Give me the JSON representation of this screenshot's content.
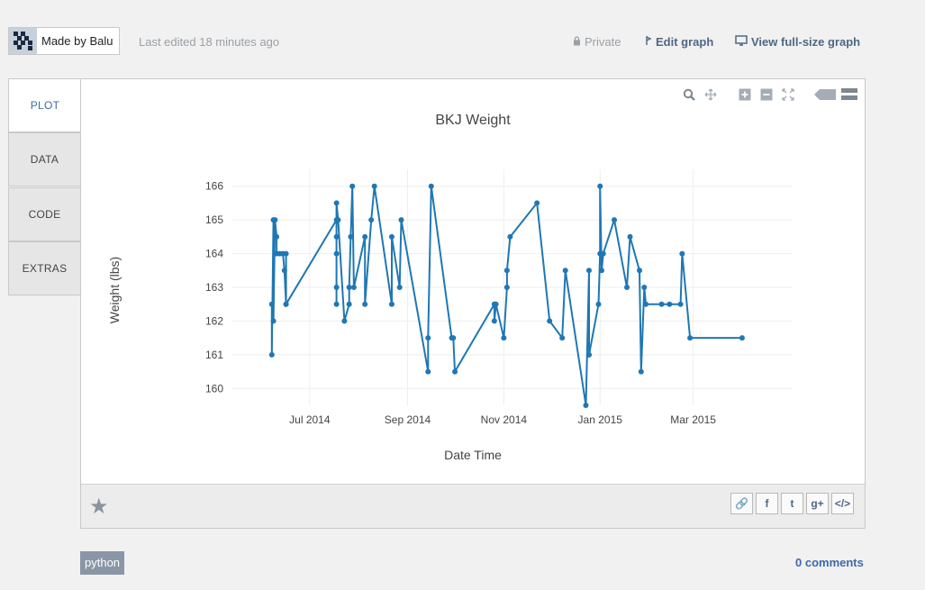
{
  "header": {
    "author": "Made by Balu",
    "last_edited": "Last edited 18 minutes ago",
    "private_label": "Private",
    "edit_label": "Edit graph",
    "view_label": "View full-size graph"
  },
  "tabs": [
    {
      "label": "PLOT",
      "active": true
    },
    {
      "label": "DATA",
      "active": false
    },
    {
      "label": "CODE",
      "active": false
    },
    {
      "label": "EXTRAS",
      "active": false
    }
  ],
  "modebar_icons": [
    "zoom-icon",
    "pan-icon",
    "zoom-in-icon",
    "zoom-out-icon",
    "autoscale-icon",
    "hover-closest-icon",
    "hover-compare-icon"
  ],
  "share_buttons": [
    {
      "name": "link-icon",
      "glyph": "🔗"
    },
    {
      "name": "facebook-icon",
      "glyph": "f"
    },
    {
      "name": "twitter-icon",
      "glyph": "t"
    },
    {
      "name": "google-plus-icon",
      "glyph": "g+"
    },
    {
      "name": "embed-icon",
      "glyph": "</>"
    }
  ],
  "tag": "python",
  "comments": "0 comments",
  "colors": {
    "line": "#1f77b4",
    "accent": "#3e6aa8"
  },
  "chart_data": {
    "type": "line",
    "title": "BKJ Weight",
    "xlabel": "Date Time",
    "ylabel": "Weight (lbs)",
    "ylim": [
      159.5,
      166.5
    ],
    "yticks": [
      160,
      161,
      162,
      163,
      164,
      165,
      166
    ],
    "xticks": [
      {
        "date": "2014-07-01",
        "label": "Jul 2014"
      },
      {
        "date": "2014-09-01",
        "label": "Sep 2014"
      },
      {
        "date": "2014-11-01",
        "label": "Nov 2014"
      },
      {
        "date": "2015-01-01",
        "label": "Jan 2015"
      },
      {
        "date": "2015-03-01",
        "label": "Mar 2015"
      }
    ],
    "xlim": [
      "2014-05-13",
      "2015-05-03"
    ],
    "grid": true,
    "series": [
      {
        "points": [
          [
            "2014-06-07",
            162.5
          ],
          [
            "2014-06-07",
            161.0
          ],
          [
            "2014-06-08",
            165.0
          ],
          [
            "2014-06-08",
            162.0
          ],
          [
            "2014-06-09",
            165.0
          ],
          [
            "2014-06-10",
            164.5
          ],
          [
            "2014-06-10",
            164.0
          ],
          [
            "2014-06-12",
            164.0
          ],
          [
            "2014-06-14",
            164.0
          ],
          [
            "2014-06-15",
            163.5
          ],
          [
            "2014-06-16",
            162.5
          ],
          [
            "2014-06-16",
            164.0
          ],
          [
            "2014-06-16",
            162.5
          ],
          [
            "2014-07-18",
            165.0
          ],
          [
            "2014-07-18",
            164.5
          ],
          [
            "2014-07-18",
            164.0
          ],
          [
            "2014-07-18",
            163.0
          ],
          [
            "2014-07-18",
            162.5
          ],
          [
            "2014-07-18",
            165.5
          ],
          [
            "2014-07-19",
            165.0
          ],
          [
            "2014-07-23",
            162.0
          ],
          [
            "2014-07-26",
            162.5
          ],
          [
            "2014-07-26",
            163.0
          ],
          [
            "2014-07-27",
            164.5
          ],
          [
            "2014-07-28",
            166.0
          ],
          [
            "2014-07-29",
            163.0
          ],
          [
            "2014-08-05",
            164.5
          ],
          [
            "2014-08-05",
            162.5
          ],
          [
            "2014-08-09",
            165.0
          ],
          [
            "2014-08-11",
            166.0
          ],
          [
            "2014-08-22",
            162.5
          ],
          [
            "2014-08-22",
            164.5
          ],
          [
            "2014-08-27",
            163.0
          ],
          [
            "2014-08-28",
            165.0
          ],
          [
            "2014-09-14",
            160.5
          ],
          [
            "2014-09-14",
            161.5
          ],
          [
            "2014-09-16",
            166.0
          ],
          [
            "2014-09-29",
            161.5
          ],
          [
            "2014-09-30",
            161.5
          ],
          [
            "2014-10-01",
            160.5
          ],
          [
            "2014-10-26",
            162.5
          ],
          [
            "2014-10-26",
            162.0
          ],
          [
            "2014-10-27",
            162.5
          ],
          [
            "2014-11-01",
            161.5
          ],
          [
            "2014-11-03",
            163.0
          ],
          [
            "2014-11-03",
            163.5
          ],
          [
            "2014-11-05",
            164.5
          ],
          [
            "2014-11-22",
            165.5
          ],
          [
            "2014-11-30",
            162.0
          ],
          [
            "2014-12-08",
            161.5
          ],
          [
            "2014-12-10",
            163.5
          ],
          [
            "2014-12-23",
            159.5
          ],
          [
            "2014-12-25",
            163.5
          ],
          [
            "2014-12-25",
            161.0
          ],
          [
            "2014-12-25",
            161.0
          ],
          [
            "2014-12-31",
            162.5
          ],
          [
            "2015-01-01",
            164.0
          ],
          [
            "2015-01-01",
            166.0
          ],
          [
            "2015-01-02",
            163.5
          ],
          [
            "2015-01-03",
            164.0
          ],
          [
            "2015-01-10",
            165.0
          ],
          [
            "2015-01-18",
            163.0
          ],
          [
            "2015-01-20",
            164.5
          ],
          [
            "2015-01-26",
            163.5
          ],
          [
            "2015-01-27",
            160.5
          ],
          [
            "2015-01-29",
            163.0
          ],
          [
            "2015-01-30",
            162.5
          ],
          [
            "2015-02-09",
            162.5
          ],
          [
            "2015-02-14",
            162.5
          ],
          [
            "2015-02-21",
            162.5
          ],
          [
            "2015-02-22",
            164.0
          ],
          [
            "2015-02-27",
            161.5
          ],
          [
            "2015-04-01",
            161.5
          ]
        ]
      }
    ]
  }
}
